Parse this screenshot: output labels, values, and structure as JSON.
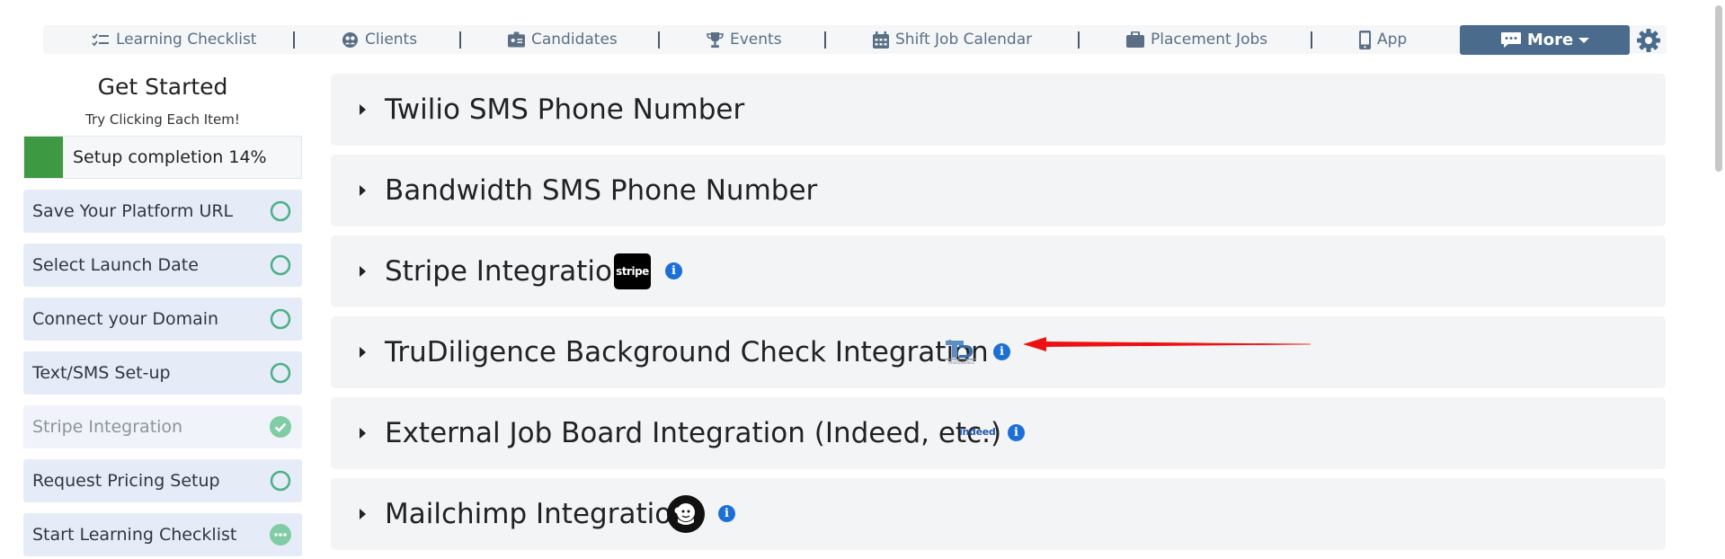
{
  "nav": {
    "items": [
      {
        "label": "Learning Checklist",
        "icon": "checklist-icon"
      },
      {
        "label": "Clients",
        "icon": "clients-icon"
      },
      {
        "label": "Candidates",
        "icon": "id-badge-icon"
      },
      {
        "label": "Events",
        "icon": "trophy-icon"
      },
      {
        "label": "Shift Job Calendar",
        "icon": "calendar-icon"
      },
      {
        "label": "Placement Jobs",
        "icon": "briefcase-icon"
      },
      {
        "label": "App",
        "icon": "mobile-icon"
      }
    ],
    "more_label": "More",
    "settings_icon": "gear-icon"
  },
  "sidebar": {
    "title": "Get Started",
    "subtitle": "Try Clicking Each Item!",
    "progress_label": "Setup completion 14%",
    "progress_fraction": 0.14,
    "steps": [
      {
        "label": "Save Your Platform URL",
        "status": "incomplete"
      },
      {
        "label": "Select Launch Date",
        "status": "incomplete"
      },
      {
        "label": "Connect your Domain",
        "status": "incomplete"
      },
      {
        "label": "Text/SMS Set-up",
        "status": "incomplete"
      },
      {
        "label": "Stripe Integration",
        "status": "complete"
      },
      {
        "label": "Request Pricing Setup",
        "status": "incomplete"
      },
      {
        "label": "Start Learning Checklist",
        "status": "in-progress"
      }
    ]
  },
  "panels": [
    {
      "title": "Twilio SMS Phone Number"
    },
    {
      "title": "Bandwidth SMS Phone Number"
    },
    {
      "title": "Stripe Integration",
      "logo_text": "stripe"
    },
    {
      "title": "TruDiligence Background Check Integration",
      "logo_text": "TRUDILIGENCE"
    },
    {
      "title": "External Job Board Integration (Indeed, etc.)",
      "logo_text": "indeed"
    },
    {
      "title": "Mailchimp Integration"
    }
  ],
  "colors": {
    "accent": "#4b6b8c",
    "progress": "#3d9a43",
    "step_circle": "#4caf88",
    "info": "#1b6fd6",
    "arrow": "#ee1111"
  }
}
